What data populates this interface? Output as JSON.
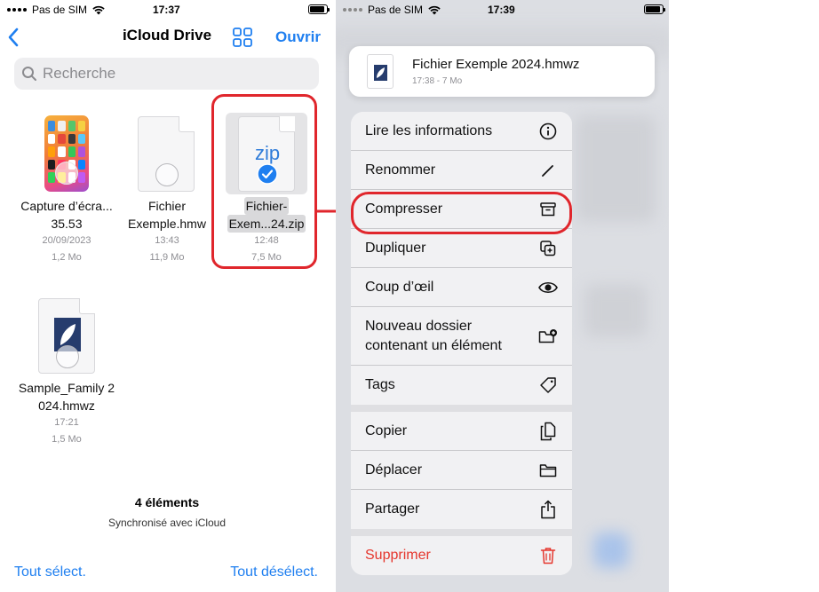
{
  "left": {
    "status": {
      "carrier": "Pas de SIM",
      "time": "17:37"
    },
    "nav": {
      "title": "iCloud Drive",
      "open_label": "Ouvrir"
    },
    "search": {
      "placeholder": "Recherche"
    },
    "files": [
      {
        "name": "Capture d’écra...35.53",
        "date": "20/09/2023",
        "size": "1,2 Mo"
      },
      {
        "name": "Fichier Exemple.hmw",
        "date": "13:43",
        "size": "11,9 Mo"
      },
      {
        "name_line1": "Fichier-",
        "name_line2": "Exem...24.zip",
        "date": "12:48",
        "size": "7,5 Mo",
        "badge": "zip"
      },
      {
        "name": "Sample_Family 2024.hmwz",
        "date": "17:21",
        "size": "1,5 Mo"
      }
    ],
    "summary": {
      "count": "4 éléments",
      "sync": "Synchronisé avec iCloud"
    },
    "toolbar": {
      "select_all": "Tout sélect.",
      "deselect_all": "Tout désélect."
    }
  },
  "right": {
    "status": {
      "carrier": "Pas de SIM",
      "time": "17:39"
    },
    "header": {
      "title": "Fichier Exemple 2024.hmwz",
      "subtitle": "17:38 - 7 Mo"
    },
    "menu": {
      "info": "Lire les informations",
      "rename": "Renommer",
      "compress": "Compresser",
      "duplicate": "Dupliquer",
      "quicklook": "Coup d’œil",
      "new_folder_line1": "Nouveau dossier",
      "new_folder_line2": "contenant un élément",
      "tags": "Tags",
      "copy": "Copier",
      "move": "Déplacer",
      "share": "Partager",
      "delete": "Supprimer"
    }
  },
  "colors": {
    "accent": "#1f7ff0",
    "highlight": "#e0262c",
    "danger": "#e5362d"
  }
}
